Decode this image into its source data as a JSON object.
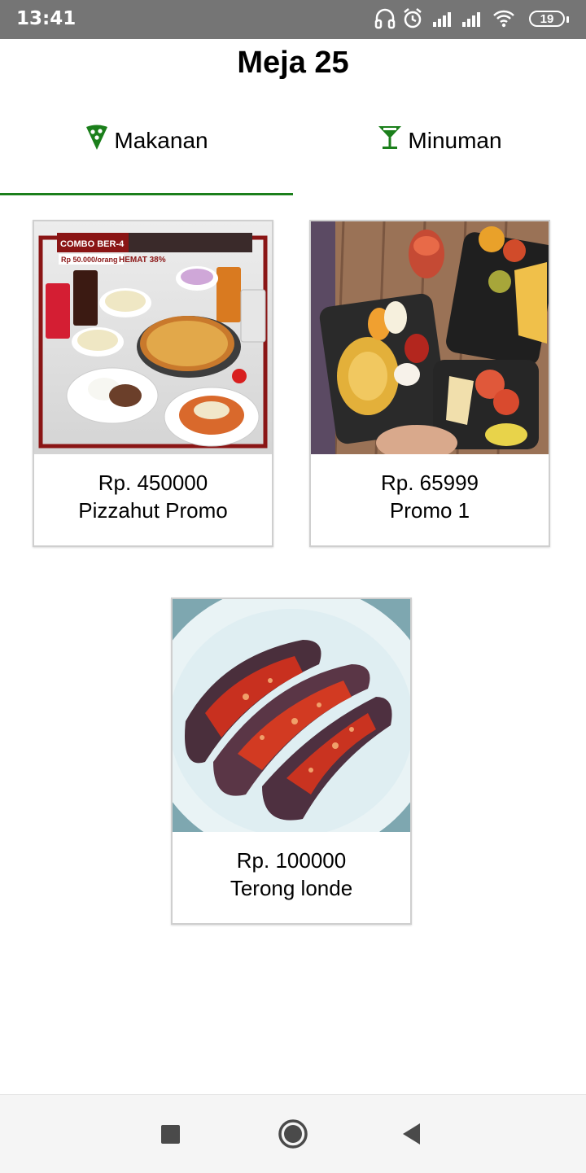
{
  "status_bar": {
    "time": "13:41",
    "battery": "19",
    "icons": [
      "headphones-icon",
      "alarm-icon",
      "signal-icon",
      "signal-icon",
      "wifi-icon",
      "battery-icon"
    ]
  },
  "header": {
    "title": "Meja 25"
  },
  "tabs": [
    {
      "label": "Makanan",
      "icon": "pizza-icon",
      "selected": true
    },
    {
      "label": "Minuman",
      "icon": "cocktail-icon",
      "selected": false
    }
  ],
  "colors": {
    "accent": "#1b7f1b",
    "status_bar": "#757575"
  },
  "menu_items": [
    {
      "price": "Rp. 450000",
      "name": "Pizzahut Promo",
      "image_text": {
        "combo": "COMBO BER-4",
        "price": "Rp 50.000/orang",
        "hemat": "HEMAT 38%"
      }
    },
    {
      "price": "Rp. 65999",
      "name": "Promo 1"
    },
    {
      "price": "Rp. 100000",
      "name": "Terong londe"
    }
  ],
  "nav_bar": {
    "buttons": [
      "recents-button",
      "home-button",
      "back-button"
    ]
  }
}
